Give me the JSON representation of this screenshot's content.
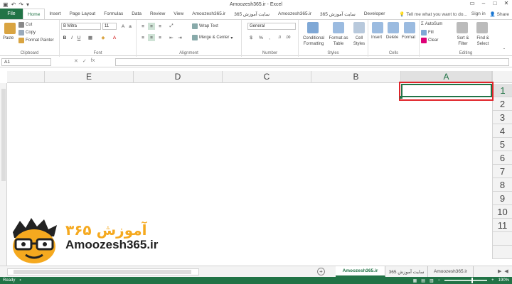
{
  "window": {
    "title": "Amoozesh365.ir - Excel"
  },
  "ribbon_tabs": {
    "file": "File",
    "items": [
      "Home",
      "Insert",
      "Page Layout",
      "Formulas",
      "Data",
      "Review",
      "View",
      "Amoozesh365.ir",
      "سایت آموزش 365",
      "Amoozesh365.ir",
      "سایت آموزش 365",
      "Developer"
    ],
    "active": "Home",
    "tell_me": "Tell me what you want to do...",
    "sign_in": "Sign in",
    "share": "Share"
  },
  "ribbon": {
    "clipboard": {
      "label": "Clipboard",
      "paste": "Paste",
      "cut": "Cut",
      "copy": "Copy",
      "format_painter": "Format Painter"
    },
    "font": {
      "label": "Font",
      "name": "B Mitra",
      "size": "11"
    },
    "alignment": {
      "label": "Alignment",
      "wrap_text": "Wrap Text",
      "merge_center": "Merge & Center"
    },
    "number": {
      "label": "Number",
      "format": "General"
    },
    "styles": {
      "label": "Styles",
      "conditional": "Conditional Formatting",
      "format_table": "Format as Table",
      "cell_styles": "Cell Styles"
    },
    "cells": {
      "label": "Cells",
      "insert": "Insert",
      "delete": "Delete",
      "format": "Format"
    },
    "editing": {
      "label": "Editing",
      "autosum": "AutoSum",
      "fill": "Fill",
      "clear": "Clear",
      "sort_filter": "Sort & Filter",
      "find_select": "Find & Select"
    }
  },
  "formula_bar": {
    "name_box": "A1",
    "fx": "fx",
    "value": ""
  },
  "grid": {
    "columns": [
      "E",
      "D",
      "C",
      "B",
      "A"
    ],
    "rows": [
      "1",
      "2",
      "3",
      "4",
      "5",
      "6",
      "7",
      "8",
      "9",
      "10",
      "11"
    ],
    "selected_column": "A",
    "selected_row": "1",
    "highlight_color": "#e0242b"
  },
  "logo": {
    "text": "Amoozesh365.ir",
    "fa_text": "آموزش ۳۶۵",
    "accent": "#f5a91f"
  },
  "sheets": {
    "tabs": [
      "Amoozesh365.ir",
      "سایت آموزش 365",
      "Amoozesh365.ir"
    ],
    "active_index": 0
  },
  "status": {
    "ready": "Ready",
    "zoom": "190%"
  },
  "colors": {
    "brand": "#217346"
  }
}
